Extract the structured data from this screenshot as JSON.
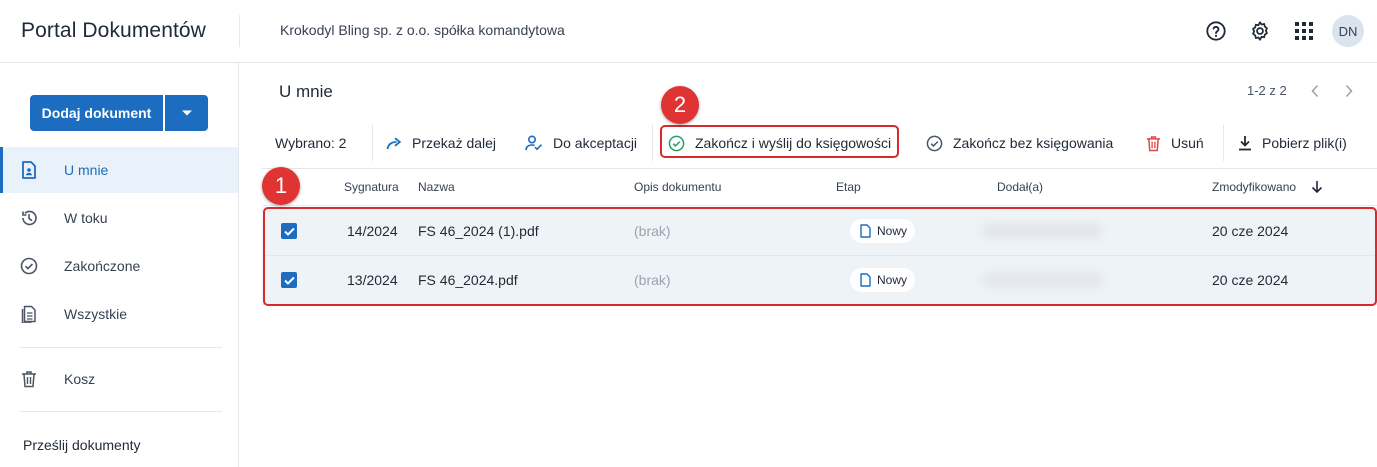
{
  "header": {
    "app_title": "Portal Dokumentów",
    "company": "Krokodyl Bling sp. z o.o. spółka komandytowa",
    "icons": [
      "help-icon",
      "gear-icon",
      "apps-grid-icon"
    ],
    "avatar_initials": "DN"
  },
  "sidebar": {
    "add_button_label": "Dodaj dokument",
    "items": [
      {
        "label": "U mnie",
        "icon": "document-user-icon",
        "active": true
      },
      {
        "label": "W toku",
        "icon": "history-icon",
        "active": false
      },
      {
        "label": "Zakończone",
        "icon": "check-circle-icon",
        "active": false
      },
      {
        "label": "Wszystkie",
        "icon": "documents-icon",
        "active": false
      },
      {
        "label": "Kosz",
        "icon": "trash-icon",
        "active": false
      }
    ],
    "section_label": "Prześlij dokumenty"
  },
  "main": {
    "title": "U mnie",
    "pagination": "1-2 z 2"
  },
  "toolbar": {
    "selected": "Wybrano: 2",
    "forward": "Przekaż dalej",
    "to_acceptance": "Do akceptacji",
    "finish_send": "Zakończ i wyślij do księgowości",
    "finish_no_accounting": "Zakończ bez księgowania",
    "delete": "Usuń",
    "download": "Pobierz plik(i)"
  },
  "annotations": {
    "step1": "1",
    "step2": "2"
  },
  "table": {
    "columns": {
      "signature": "Sygnatura",
      "name": "Nazwa",
      "description": "Opis dokumentu",
      "stage": "Etap",
      "added_by": "Dodał(a)",
      "modified": "Zmodyfikowano"
    },
    "rows": [
      {
        "signature": "14/2024",
        "name": "FS 46_2024 (1).pdf",
        "description": "(brak)",
        "stage": "Nowy",
        "modified": "20 cze 2024",
        "checked": true
      },
      {
        "signature": "13/2024",
        "name": "FS 46_2024.pdf",
        "description": "(brak)",
        "stage": "Nowy",
        "modified": "20 cze 2024",
        "checked": true
      }
    ]
  },
  "colors": {
    "primary": "#1c6dbf",
    "selected_row": "#eef3f8",
    "highlight_red": "#d62b2b",
    "delete_red": "#e04848",
    "success_green": "#22a06b"
  }
}
